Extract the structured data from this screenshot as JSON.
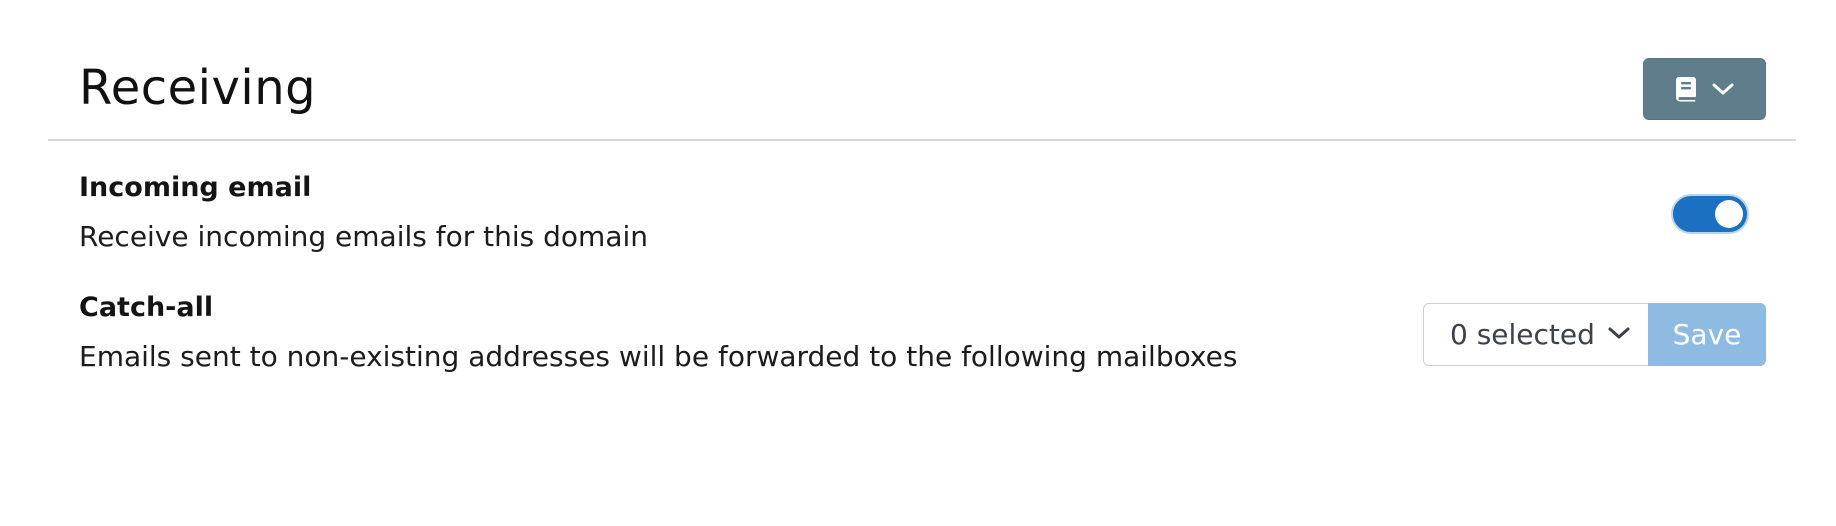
{
  "header": {
    "title": "Receiving",
    "menu_icon": "book-icon",
    "menu_chevron": "chevron-down-icon",
    "menu_color": "#607d8b"
  },
  "incoming": {
    "label": "Incoming email",
    "description": "Receive incoming emails for this domain",
    "enabled": true,
    "toggle_color": "#1b70c2"
  },
  "catchall": {
    "label": "Catch-all",
    "description": "Emails sent to non-existing addresses will be forwarded to the following mailboxes",
    "select_value": "0 selected",
    "save_label": "Save",
    "save_color": "#8fbbe2"
  }
}
